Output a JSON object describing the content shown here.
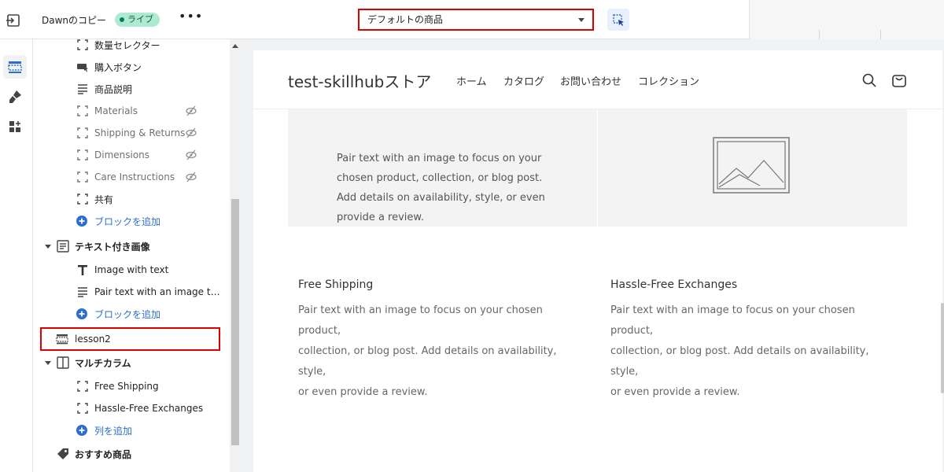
{
  "topbar": {
    "theme_name": "Dawnのコピー",
    "live_label": "ライブ",
    "more_label": "•••",
    "template_select": "デフォルトの商品"
  },
  "rail": {
    "items": [
      "sections-icon",
      "paintbrush-icon",
      "apps-icon"
    ]
  },
  "sidebar": {
    "blocks": [
      {
        "label": "数量セレクター"
      },
      {
        "label": "購入ボタン"
      },
      {
        "label": "商品説明"
      },
      {
        "label": "Materials",
        "hidden": true
      },
      {
        "label": "Shipping & Returns",
        "hidden": true
      },
      {
        "label": "Dimensions",
        "hidden": true
      },
      {
        "label": "Care Instructions",
        "hidden": true
      },
      {
        "label": "共有"
      },
      {
        "label": "ブロックを追加"
      }
    ],
    "section_image_text": {
      "label": "テキスト付き画像",
      "children": [
        "Image with text",
        "Pair text with an image to f..."
      ],
      "add_block": "ブロックを追加"
    },
    "lesson": {
      "label": "lesson2"
    },
    "section_multicolumn": {
      "label": "マルチカラム",
      "children": [
        "Free Shipping",
        "Hassle-Free Exchanges"
      ],
      "add_column": "列を追加"
    },
    "featured": {
      "label": "おすすめ商品"
    }
  },
  "preview": {
    "store_name": "test-skillhubストア",
    "nav": [
      "ホーム",
      "カタログ",
      "お問い合わせ",
      "コレクション"
    ],
    "image_with_text": {
      "lines": [
        "Pair text with an image to focus on your",
        "chosen product, collection, or blog post.",
        "Add details on availability, style, or even",
        "provide a review."
      ]
    },
    "columns": [
      {
        "title": "Free Shipping",
        "lines": [
          "Pair text with an image to focus on your chosen product,",
          "collection, or blog post. Add details on availability, style,",
          "or even provide a review."
        ]
      },
      {
        "title": "Hassle-Free Exchanges",
        "lines": [
          "Pair text with an image to focus on your chosen product,",
          "collection, or blog post. Add details on availability, style,",
          "or even provide a review."
        ]
      }
    ]
  },
  "colors": {
    "accent_link": "#2c6ecb",
    "highlight_red": "#e00000",
    "live_badge_bg": "#aee9d1"
  }
}
